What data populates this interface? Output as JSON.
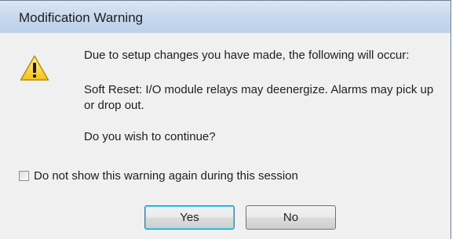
{
  "dialog": {
    "title": "Modification Warning",
    "icon": "warning-icon",
    "message_line1": "Due to setup changes you have made, the following will occur:",
    "message_line2": "Soft Reset: I/O module relays may deenergize.  Alarms may pick up or drop out.",
    "message_line3": "Do you wish to continue?",
    "checkbox": {
      "label": "Do not show this warning again during this session",
      "checked": false
    },
    "buttons": {
      "yes_label": "Yes",
      "no_label": "No"
    }
  },
  "colors": {
    "titlebar": "#c7d8ee",
    "body": "#f0f0f0",
    "default_button_border": "#3c7fb1",
    "warning_yellow": "#f6d32a"
  }
}
